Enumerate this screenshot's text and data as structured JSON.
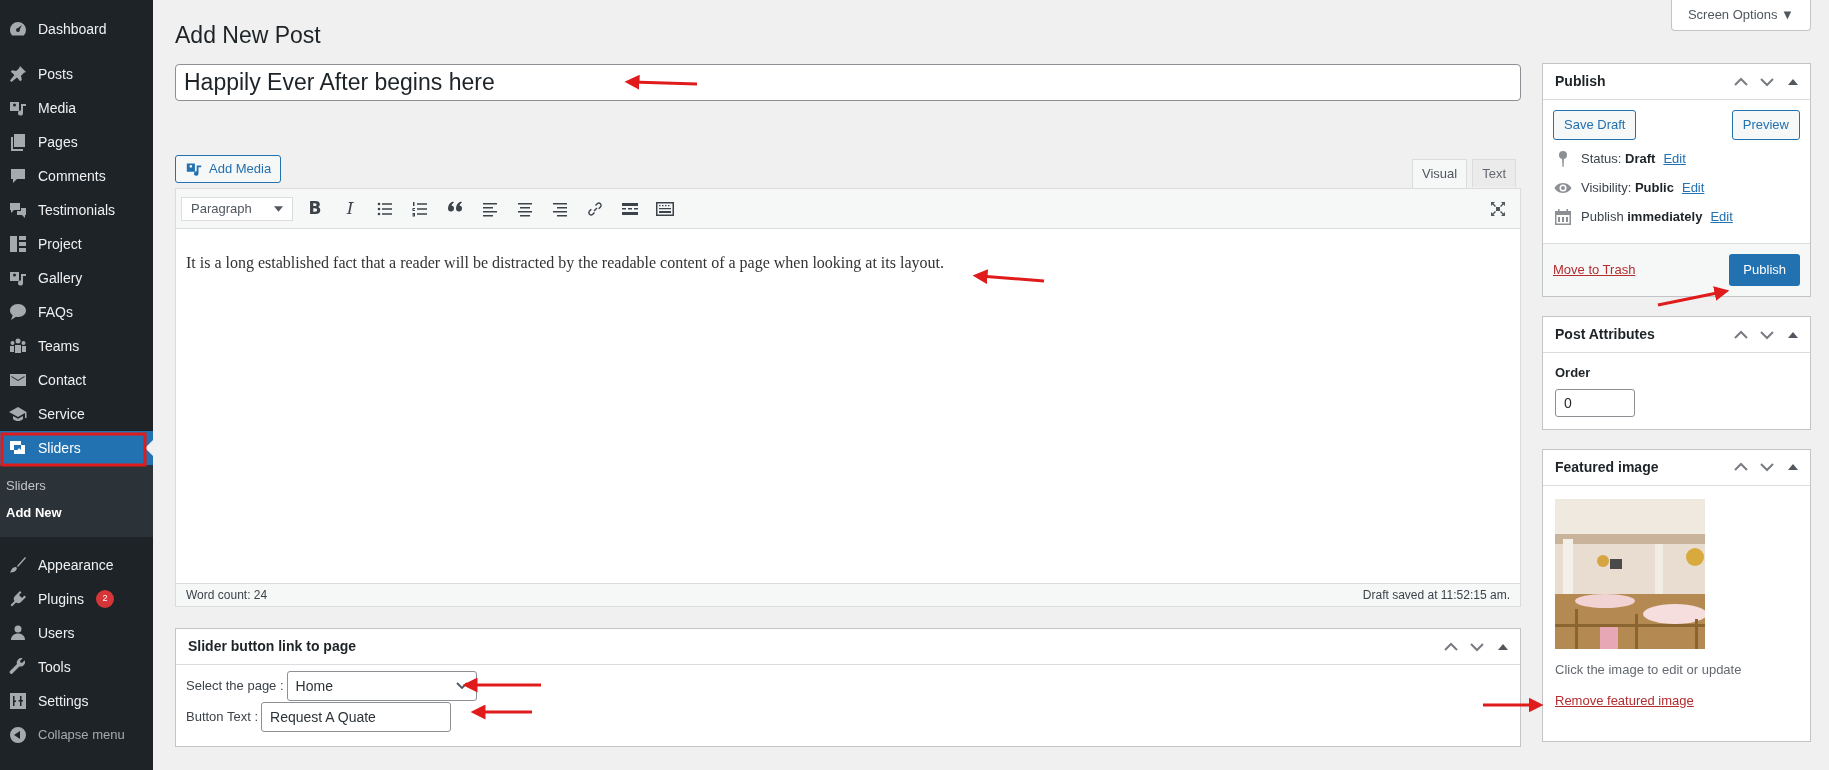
{
  "admin_menu": {
    "groups": [
      {
        "items": [
          {
            "label": "Dashboard",
            "selected": false
          }
        ]
      },
      {
        "items": [
          {
            "label": "Posts",
            "selected": false
          },
          {
            "label": "Media",
            "selected": false
          },
          {
            "label": "Pages",
            "selected": false
          },
          {
            "label": "Comments",
            "selected": false
          },
          {
            "label": "Testimonials",
            "selected": false
          },
          {
            "label": "Project",
            "selected": false
          },
          {
            "label": "Gallery",
            "selected": false
          },
          {
            "label": "FAQs",
            "selected": false
          },
          {
            "label": "Teams",
            "selected": false
          },
          {
            "label": "Contact",
            "selected": false
          },
          {
            "label": "Service",
            "selected": false
          },
          {
            "label": "Sliders",
            "selected": true,
            "children": [
              {
                "label": "Sliders",
                "selected": false
              },
              {
                "label": "Add New",
                "selected": true
              }
            ]
          }
        ]
      },
      {
        "items": [
          {
            "label": "Appearance",
            "selected": false
          },
          {
            "label": "Plugins",
            "selected": false,
            "badge": "2"
          },
          {
            "label": "Users",
            "selected": false
          },
          {
            "label": "Tools",
            "selected": false
          },
          {
            "label": "Settings",
            "selected": false
          }
        ]
      }
    ],
    "collapse": "Collapse menu"
  },
  "page_title": "Add New Post",
  "screen_options": "Screen Options ▼",
  "post_title": "Happily Ever After begins here",
  "add_media": "Add Media",
  "editor": {
    "tabs": [
      {
        "label": "Visual",
        "selected": true
      },
      {
        "label": "Text",
        "selected": false
      }
    ],
    "format": "Paragraph",
    "toolbar": [
      {
        "kind": "bold",
        "glyph": "B"
      },
      {
        "kind": "italic",
        "glyph": "I"
      },
      {
        "kind": "bullets"
      },
      {
        "kind": "numbers"
      },
      {
        "kind": "quote"
      },
      {
        "kind": "align-left"
      },
      {
        "kind": "align-center"
      },
      {
        "kind": "align-right"
      },
      {
        "kind": "link"
      },
      {
        "kind": "more"
      },
      {
        "kind": "toolbar-toggle"
      }
    ],
    "content": "It is a long established fact that a reader will be distracted by the readable content of a page when looking at its layout.",
    "word_count": "Word count: 24",
    "draft_saved": "Draft saved at 11:52:15 am."
  },
  "slider_box": {
    "title": "Slider button link to page",
    "fields": [
      {
        "kind": "select",
        "label": "Select the page :",
        "value": "Home"
      },
      {
        "kind": "text",
        "label": "Button Text :",
        "value": "Request A Quate"
      }
    ]
  },
  "publish_box": {
    "title": "Publish",
    "save_draft": "Save Draft",
    "preview": "Preview",
    "meta": [
      {
        "kind": "status",
        "label": "Status:",
        "value": "Draft",
        "link": "Edit"
      },
      {
        "kind": "visibility",
        "label": "Visibility:",
        "value": "Public",
        "link": "Edit"
      },
      {
        "kind": "schedule",
        "label": "Publish",
        "value": "immediately",
        "link": "Edit"
      }
    ],
    "trash": "Move to Trash",
    "publish": "Publish"
  },
  "attributes_box": {
    "title": "Post Attributes",
    "order_label": "Order",
    "order_value": "0"
  },
  "featured_box": {
    "title": "Featured image",
    "hint": "Click the image to edit or update",
    "remove": "Remove featured image"
  }
}
